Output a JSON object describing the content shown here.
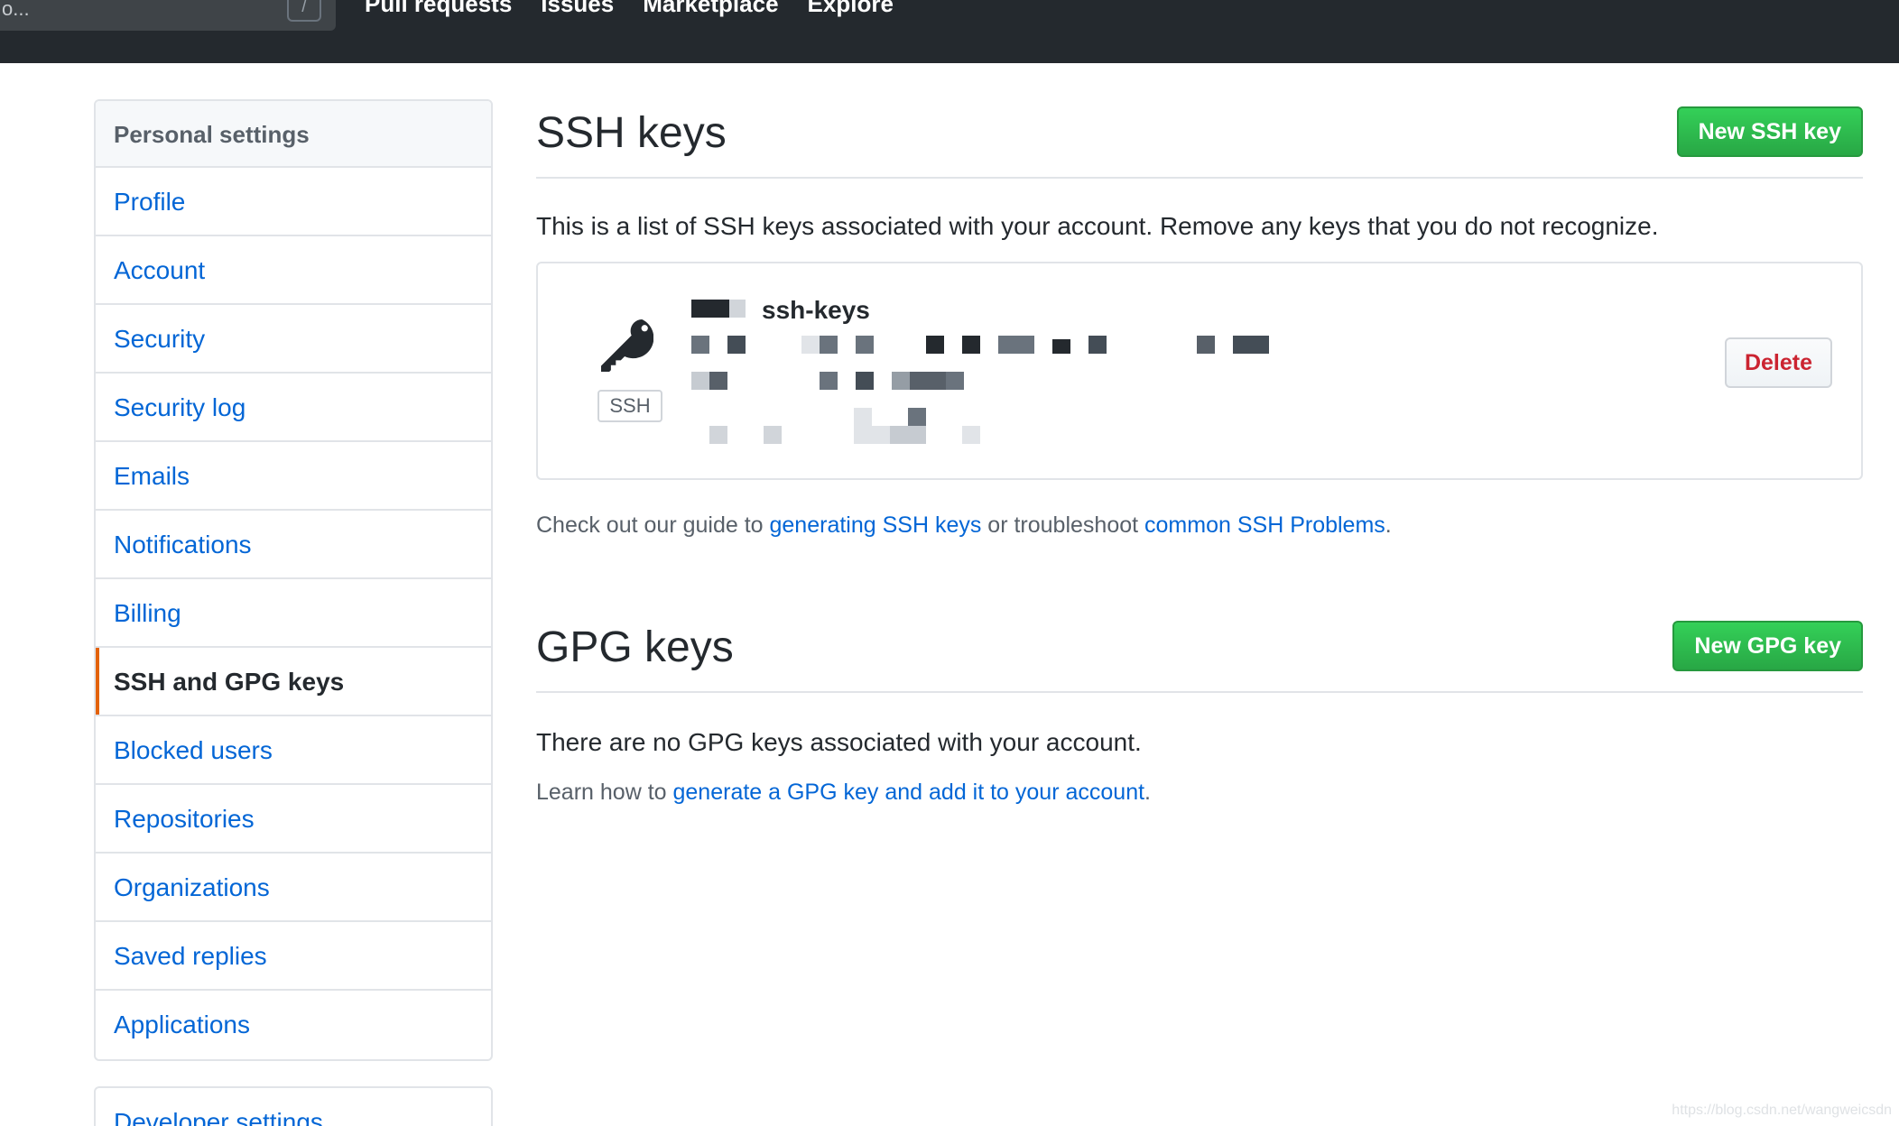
{
  "header": {
    "search_text": "o...",
    "search_shortcut": "/",
    "nav": [
      "Pull requests",
      "Issues",
      "Marketplace",
      "Explore"
    ]
  },
  "sidebar": {
    "heading": "Personal settings",
    "items": [
      {
        "label": "Profile"
      },
      {
        "label": "Account"
      },
      {
        "label": "Security"
      },
      {
        "label": "Security log"
      },
      {
        "label": "Emails"
      },
      {
        "label": "Notifications"
      },
      {
        "label": "Billing"
      },
      {
        "label": "SSH and GPG keys",
        "active": true
      },
      {
        "label": "Blocked users"
      },
      {
        "label": "Repositories"
      },
      {
        "label": "Organizations"
      },
      {
        "label": "Saved replies"
      },
      {
        "label": "Applications"
      }
    ],
    "developer_settings": "Developer settings"
  },
  "ssh": {
    "title": "SSH keys",
    "new_button": "New SSH key",
    "description": "This is a list of SSH keys associated with your account. Remove any keys that you do not recognize.",
    "key": {
      "badge": "SSH",
      "title": "ssh-keys",
      "delete_label": "Delete"
    },
    "help_prefix": "Check out our guide to ",
    "help_link1": "generating SSH keys",
    "help_middle": " or troubleshoot ",
    "help_link2": "common SSH Problems",
    "help_suffix": "."
  },
  "gpg": {
    "title": "GPG keys",
    "new_button": "New GPG key",
    "description": "There are no GPG keys associated with your account.",
    "help_prefix": "Learn how to ",
    "help_link": "generate a GPG key and add it to your account",
    "help_suffix": "."
  },
  "watermark": "https://blog.csdn.net/wangweicsdn",
  "colors": {
    "header_bg": "#24292e",
    "link": "#0366d6",
    "active_indicator": "#e36209",
    "primary_button": "#2cbe4e",
    "danger_text": "#cb2431"
  }
}
